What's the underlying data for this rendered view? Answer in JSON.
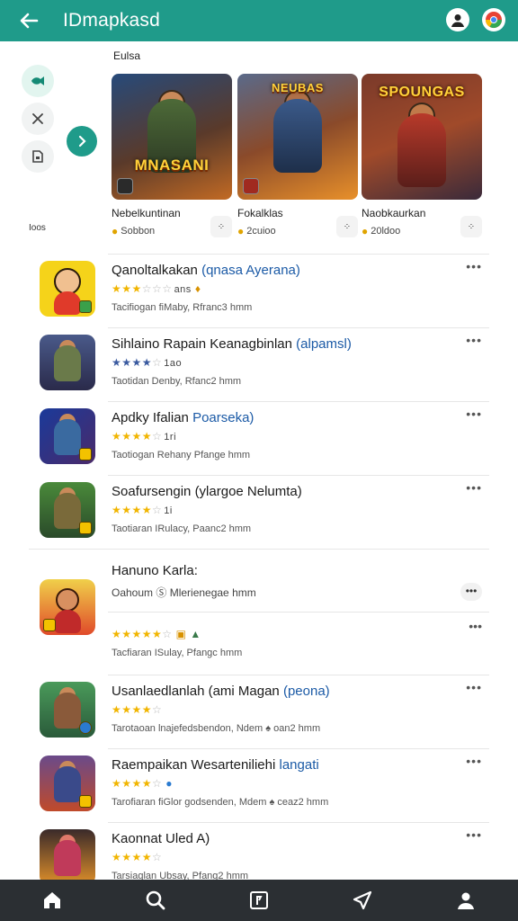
{
  "app_bar": {
    "title": "IDmapkasd",
    "back_icon": "arrow-left-icon",
    "right_icons": [
      "account-circle-icon",
      "chrome-logo-icon"
    ]
  },
  "colors": {
    "accent": "#1f9b8a",
    "bottom_nav": "#2b2f33",
    "star": "#f1b500",
    "link": "#1b5aa6"
  },
  "rail": {
    "buttons": [
      "fish-icon",
      "crossed-tools-icon",
      "save-box-icon"
    ],
    "go_icon": "chevron-right-icon",
    "side_tag": "Ioos"
  },
  "featured": {
    "label": "Eulsa",
    "cards": [
      {
        "art_title": "MNASANI",
        "name": "Nebelkuntinan",
        "rating": "Sobbon"
      },
      {
        "art_title": "NEUBAS",
        "name": "Fokalklas",
        "rating": "2cuioo"
      },
      {
        "art_title": "SPOUNGAS",
        "name": "Naobkaurkan",
        "rating": "20ldoo"
      }
    ]
  },
  "list": [
    {
      "title": "Qanoltalkakan",
      "title_accent": "(qnasa Ayerana)",
      "stars": 3.5,
      "rating_text": "ans",
      "desc": "Tacifiogan fiMaby, Rfranc3 hmm"
    },
    {
      "title": "Sihlaino Rapain Keanagbinlan",
      "title_accent": "(alpamsl)",
      "stars": 3.5,
      "rating_text": "1ao",
      "desc": "Taotidan Denby, Rfanc2 hmm"
    },
    {
      "title": "Apdky Ifalian",
      "title_accent": "Poarseka)",
      "stars": 3.5,
      "rating_text": "1ri",
      "desc": "Taotiogan Rehany Pfange hmm"
    },
    {
      "title": "Soafursengin (ylargoe Nelumta)",
      "title_accent": "",
      "stars": 3.5,
      "rating_text": "1i",
      "desc": "Taotiaran IRulacy, Paanc2 hmm"
    },
    {
      "title": "Hanuno Karla:",
      "subtitle": "Oahoum Ⓢ Mlerienegae hmm",
      "title_accent": "",
      "stars": 4.5,
      "rating_text": "",
      "desc": "Tacfiaran ISulay, Pfangc hmm"
    },
    {
      "title": "Usanlaedlanlah (ami Magan",
      "title_accent": "(peona)",
      "stars": 3.5,
      "rating_text": "",
      "desc": "Tarotaoan lnajefedsbendon, Ndem ♠ oan2 hmm"
    },
    {
      "title": "Raempaikan Wesarteniliehi",
      "title_accent": "langati",
      "stars": 3.5,
      "rating_text": "",
      "desc": "Tarofiaran fiGlor godsenden, Mdem ♠ ceaz2 hmm"
    },
    {
      "title": "Kaonnat Uled A)",
      "title_accent": "",
      "stars": 3.5,
      "rating_text": "",
      "desc": "Tarsiaglan Ubsay, Pfang2 hmm"
    }
  ],
  "bottom_nav": [
    "home-icon",
    "search-icon",
    "library-icon",
    "send-icon",
    "profile-icon"
  ]
}
